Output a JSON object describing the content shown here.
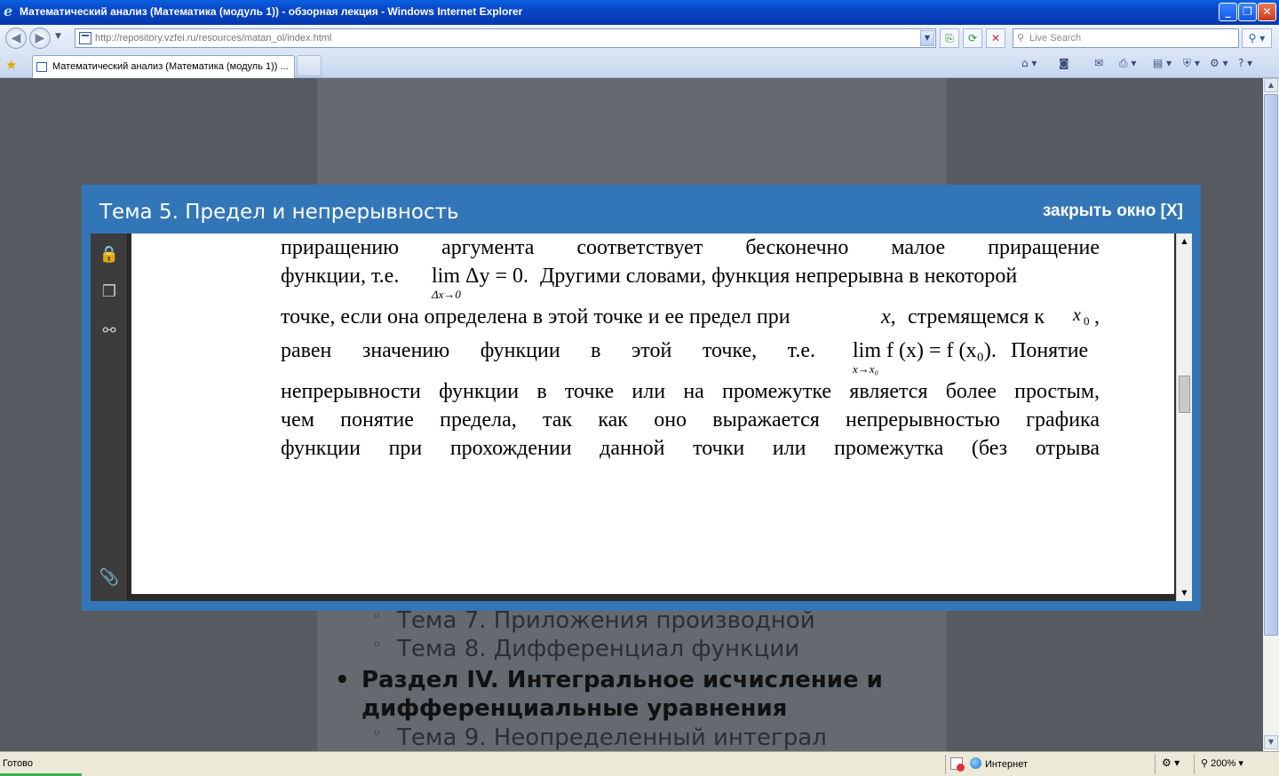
{
  "window": {
    "title": "Математический анализ (Математика (модуль 1)) - обзорная лекция - Windows Internet Explorer"
  },
  "address": {
    "url": "http://repository.vzfei.ru/resources/matan_ol/index.html"
  },
  "search": {
    "placeholder": "Live Search"
  },
  "tab": {
    "label": "Математический анализ (Математика (модуль 1)) ..."
  },
  "toc": {
    "items": [
      {
        "label": "Тема 7. Приложения производной"
      },
      {
        "label": "Тема 8. Дифференциал функции"
      }
    ],
    "section": {
      "label": "Раздел IV. Интегральное исчисление и дифференциальные уравнения"
    },
    "after": [
      {
        "label": "Тема 9. Неопределенный интеграл"
      }
    ]
  },
  "modal": {
    "title": "Тема 5. Предел и непрерывность",
    "close_label": "закрыть окно [X]"
  },
  "document": {
    "line1": "приращению аргумента соответствует бесконечно малое приращение",
    "line2_pre": "функции, т.е.",
    "line2_math": "lim Δy = 0.",
    "line2_math_sub": "Δx→0",
    "line2_post": "Другими словами, функция непрерывна в некоторой",
    "line3_pre": "точке, если она определена в этой точке и ее предел при",
    "line3_var": "x,",
    "line3_mid": "стремящемся к",
    "line3_x0": "x",
    "line3_x0_sub": "0",
    "line3_post": ",",
    "line4_pre": "равен значению функции в этой точке, т.е.",
    "line4_math": "lim f (x) = f (x₀).",
    "line4_math_sub": "x→x₀",
    "line4_post": "Понятие",
    "line5": "непрерывности функции в точке или на промежутке является более простым,",
    "line6": "чем понятие предела, так как оно выражается непрерывностью графика",
    "line7": "функции при прохождении данной точки или промежутка (без отрыва"
  },
  "status": {
    "text": "Готово",
    "zone": "Интернет",
    "zoom": "200%"
  },
  "icons": [
    "ie-logo-icon",
    "back-icon",
    "forward-icon",
    "refresh-icon",
    "stop-icon",
    "search-icon",
    "favorites-star-icon",
    "home-icon",
    "feeds-icon",
    "mail-icon",
    "print-icon",
    "page-icon",
    "safety-icon",
    "tools-icon",
    "help-icon",
    "lock-icon",
    "pages-icon",
    "binoculars-icon",
    "paperclip-icon",
    "globe-icon",
    "zoom-icon"
  ]
}
